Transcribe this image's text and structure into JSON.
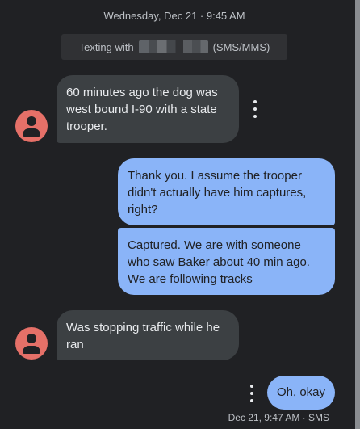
{
  "header": {
    "date_time": "Wednesday, Dec 21 · 9:45 AM"
  },
  "banner": {
    "prefix": "Texting with",
    "suffix": "(SMS/MMS)"
  },
  "messages": [
    {
      "direction": "incoming",
      "text": "60 minutes ago the dog was west bound I-90 with a state trooper."
    },
    {
      "direction": "outgoing",
      "text": "Thank you. I assume the trooper didn't actually have him captures, right?"
    },
    {
      "direction": "outgoing",
      "text": "Captured. We are with someone who saw Baker about 40 min ago. We are following tracks"
    },
    {
      "direction": "incoming",
      "text": "Was stopping traffic while he ran"
    },
    {
      "direction": "outgoing",
      "text": "Oh, okay"
    }
  ],
  "last_message_meta": "Dec 21, 9:47 AM · SMS",
  "icons": {
    "avatar": "person-avatar-icon",
    "menu": "more-vert-icon"
  },
  "colors": {
    "background": "#202124",
    "incoming_bubble": "#3c4043",
    "outgoing_bubble": "#8ab4f8",
    "avatar": "#e57068",
    "banner": "#303134"
  }
}
